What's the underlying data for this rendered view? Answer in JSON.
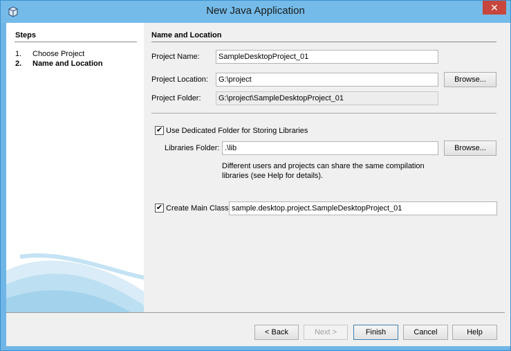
{
  "window": {
    "title": "New Java Application",
    "close_glyph": "✕"
  },
  "steps": {
    "title": "Steps",
    "items": [
      {
        "num": "1.",
        "label": "Choose Project"
      },
      {
        "num": "2.",
        "label": "Name and Location"
      }
    ]
  },
  "section": {
    "title": "Name and Location"
  },
  "form": {
    "project_name_label": "Project Name:",
    "project_name_value": "SampleDesktopProject_01",
    "project_location_label": "Project Location:",
    "project_location_value": "G:\\project",
    "project_folder_label": "Project Folder:",
    "project_folder_value": "G:\\project\\SampleDesktopProject_01",
    "browse_label": "Browse...",
    "dedicated_folder_label": "Use Dedicated Folder for Storing Libraries",
    "dedicated_folder_checked": true,
    "libraries_folder_label": "Libraries Folder:",
    "libraries_folder_value": ".\\lib",
    "hint_text": "Different users and projects can share the same compilation libraries (see Help for details).",
    "create_main_class_label": "Create Main Class",
    "create_main_class_checked": true,
    "main_class_value": "sample.desktop.project.SampleDesktopProject_01"
  },
  "buttons": {
    "back": "< Back",
    "next": "Next >",
    "finish": "Finish",
    "cancel": "Cancel",
    "help": "Help"
  },
  "icons": {
    "app": "java-app-icon",
    "close": "close-icon",
    "checkbox": "checkmark-icon"
  },
  "colors": {
    "title_bar": "#74bbe9",
    "close_button": "#c7463d",
    "dialog_background": "#f0f0f0"
  }
}
